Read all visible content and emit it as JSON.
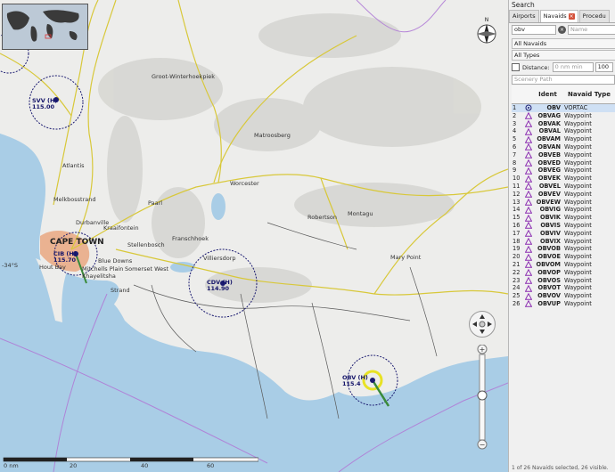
{
  "panel": {
    "title": "Search",
    "tabs": [
      {
        "label": "Airports",
        "closable": false
      },
      {
        "label": "Navaids",
        "closable": true
      },
      {
        "label": "Procedu",
        "closable": false
      }
    ],
    "search": {
      "value": "obv",
      "name_placeholder": "Name"
    },
    "filter_navaids": "All Navaids",
    "filter_types": "All Types",
    "distance": {
      "label": "Distance:",
      "placeholder": "0 nm min",
      "max_value": "100"
    },
    "scenery_placeholder": "Scenery Path",
    "table": {
      "headers": {
        "ident": "Ident",
        "type": "Navaid Type"
      },
      "rows": [
        {
          "n": "1",
          "ident": "OBV",
          "type": "VORTAC"
        },
        {
          "n": "2",
          "ident": "OBVAG",
          "type": "Waypoint"
        },
        {
          "n": "3",
          "ident": "OBVAK",
          "type": "Waypoint"
        },
        {
          "n": "4",
          "ident": "OBVAL",
          "type": "Waypoint"
        },
        {
          "n": "5",
          "ident": "OBVAM",
          "type": "Waypoint"
        },
        {
          "n": "6",
          "ident": "OBVAN",
          "type": "Waypoint"
        },
        {
          "n": "7",
          "ident": "OBVEB",
          "type": "Waypoint"
        },
        {
          "n": "8",
          "ident": "OBVED",
          "type": "Waypoint"
        },
        {
          "n": "9",
          "ident": "OBVEG",
          "type": "Waypoint"
        },
        {
          "n": "10",
          "ident": "OBVEK",
          "type": "Waypoint"
        },
        {
          "n": "11",
          "ident": "OBVEL",
          "type": "Waypoint"
        },
        {
          "n": "12",
          "ident": "OBVEV",
          "type": "Waypoint"
        },
        {
          "n": "13",
          "ident": "OBVEW",
          "type": "Waypoint"
        },
        {
          "n": "14",
          "ident": "OBVIG",
          "type": "Waypoint"
        },
        {
          "n": "15",
          "ident": "OBVIK",
          "type": "Waypoint"
        },
        {
          "n": "16",
          "ident": "OBVIS",
          "type": "Waypoint"
        },
        {
          "n": "17",
          "ident": "OBVIV",
          "type": "Waypoint"
        },
        {
          "n": "18",
          "ident": "OBVIX",
          "type": "Waypoint"
        },
        {
          "n": "19",
          "ident": "OBVOB",
          "type": "Waypoint"
        },
        {
          "n": "20",
          "ident": "OBVOE",
          "type": "Waypoint"
        },
        {
          "n": "21",
          "ident": "OBVOM",
          "type": "Waypoint"
        },
        {
          "n": "22",
          "ident": "OBVOP",
          "type": "Waypoint"
        },
        {
          "n": "23",
          "ident": "OBVOS",
          "type": "Waypoint"
        },
        {
          "n": "24",
          "ident": "OBVOT",
          "type": "Waypoint"
        },
        {
          "n": "25",
          "ident": "OBVOV",
          "type": "Waypoint"
        },
        {
          "n": "26",
          "ident": "OBVUP",
          "type": "Waypoint"
        }
      ]
    },
    "status": "1 of 26 Navaids selected, 26 visible."
  },
  "map": {
    "places": {
      "groot": "Groot-Winterhoekpiek",
      "matroosberg": "Matroosberg",
      "atlantis": "Atlantis",
      "melkbosstrand": "Melkbosstrand",
      "durbanville": "Durbanville",
      "kraaifontein": "Kraaifontein",
      "paarl": "Paarl",
      "worcester": "Worcester",
      "robertson": "Robertson",
      "montagu": "Montagu",
      "capetown": "CAPE TOWN",
      "stellenbosch": "Stellenbosch",
      "franschhoek": "Franschhoek",
      "villiersdorp": "Villiersdorp",
      "somerset": "Somerset West",
      "mitchells": "Mitchells Plain",
      "khayelitsha": "Khayelitsha",
      "bluedowns": "Blue Downs",
      "strand": "Strand",
      "houtbay": "Hout Bay",
      "marypoint": "Mary Point",
      "lat": "-34°S"
    },
    "navaids": {
      "svv": {
        "name": "SVV (H)",
        "freq": "115.00"
      },
      "cib": {
        "name": "CIB (H)",
        "freq": "115.70"
      },
      "cdv": {
        "name": "CDV (H)",
        "freq": "114.90"
      },
      "obv": {
        "name": "OBV (H)",
        "freq": "115.4"
      }
    },
    "scale": {
      "labels": [
        "0 nm",
        "20",
        "40",
        "60"
      ]
    }
  },
  "colors": {
    "water": "#a9cde6",
    "land": "#ededeb",
    "navaid": "#1a1a70",
    "roads": "#d8c83a",
    "border": "#b07cd6"
  }
}
